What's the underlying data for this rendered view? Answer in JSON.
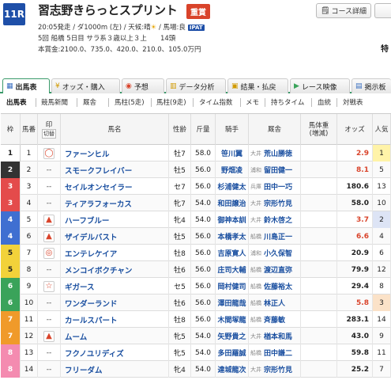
{
  "header": {
    "race_number": "11R",
    "title": "習志野きらっとスプリント",
    "grade": "重賞",
    "course_button": "コース詳細",
    "info_line1": "20:05発走 / ダ1000m (左) / 天候:晴",
    "track_condition": "/ 馬場:良",
    "ipat": "IPAT",
    "info_line2": "5回 船橋 5日目 サラ系３歳以上３上",
    "horse_count": "14頭",
    "prize": "本賞金:2100.0、735.0、420.0、210.0、105.0万円",
    "right_fragment": "特"
  },
  "tabs": [
    {
      "label": "出馬表",
      "icon": "table-icon"
    },
    {
      "label": "オッズ・購入",
      "icon": "coins-icon"
    },
    {
      "label": "予想",
      "icon": "forecast-icon"
    },
    {
      "label": "データ分析",
      "icon": "chart-icon"
    },
    {
      "label": "結果・払戻",
      "icon": "result-icon"
    },
    {
      "label": "レース映像",
      "icon": "video-icon"
    },
    {
      "label": "掲示板",
      "icon": "board-icon"
    }
  ],
  "subtabs": [
    "出馬表",
    "競馬新聞",
    "厩舎",
    "馬柱(5走)",
    "馬柱(9走)",
    "タイム指数",
    "メモ",
    "持ちタイム",
    "血統",
    "対戦表"
  ],
  "columns": [
    "枠",
    "馬番",
    "印",
    "馬名",
    "性齢",
    "斤量",
    "騎手",
    "厩舎",
    "馬体重(増減)",
    "オッズ",
    "人気"
  ],
  "mark_header": [
    "印",
    "印"
  ],
  "mark_sub": "切替",
  "colors": {
    "waku1": "#ffffff",
    "waku2": "#333333",
    "waku3": "#e44b4b",
    "waku4": "#3f6fd1",
    "waku5": "#f2d23a",
    "waku6": "#3aa35a",
    "waku7": "#f09a2a",
    "waku8": "#f48bb0",
    "accent": "#3a9a6a",
    "odds_hot": "#d9432a"
  },
  "rows": [
    {
      "waku": "1",
      "uma": "1",
      "mark": "circle",
      "horse": "ファーンヒル",
      "age": "牡7",
      "weight": "58.0",
      "jockey": "笹川翼",
      "area": "大井",
      "trainer": "荒山勝徳",
      "odds": "2.9",
      "hot": true,
      "pop": "1"
    },
    {
      "waku": "2",
      "uma": "2",
      "mark": "--",
      "horse": "スモークフレイバー",
      "age": "牡5",
      "weight": "56.0",
      "jockey": "野畑凌",
      "area": "浦和",
      "trainer": "留田健一",
      "odds": "8.1",
      "hot": true,
      "pop": "5"
    },
    {
      "waku": "3",
      "uma": "3",
      "mark": "--",
      "horse": "セイルオンセイラー",
      "age": "セ7",
      "weight": "56.0",
      "jockey": "杉浦健太",
      "area": "兵庫",
      "trainer": "田中一巧",
      "odds": "180.6",
      "hot": false,
      "pop": "13"
    },
    {
      "waku": "3",
      "uma": "4",
      "mark": "--",
      "horse": "ティアラフォーカス",
      "age": "牝7",
      "weight": "54.0",
      "jockey": "和田譲治",
      "area": "大井",
      "trainer": "宗形竹見",
      "odds": "58.0",
      "hot": false,
      "pop": "10"
    },
    {
      "waku": "4",
      "uma": "5",
      "mark": "triangle",
      "horse": "ハーフブルー",
      "age": "牝4",
      "weight": "54.0",
      "jockey": "御神本訓",
      "area": "大井",
      "trainer": "鈴木啓之",
      "odds": "3.7",
      "hot": true,
      "pop": "2"
    },
    {
      "waku": "4",
      "uma": "6",
      "mark": "triangle",
      "horse": "ザイデルバスト",
      "age": "牡5",
      "weight": "56.0",
      "jockey": "本橋孝太",
      "area": "船橋",
      "trainer": "川島正一",
      "odds": "6.6",
      "hot": true,
      "pop": "4"
    },
    {
      "waku": "5",
      "uma": "7",
      "mark": "double",
      "horse": "エンテレケイア",
      "age": "牡8",
      "weight": "56.0",
      "jockey": "吉原寛人",
      "area": "浦和",
      "trainer": "小久保智",
      "odds": "20.9",
      "hot": false,
      "pop": "6"
    },
    {
      "waku": "5",
      "uma": "8",
      "mark": "--",
      "horse": "メンコイボクチャン",
      "age": "牡6",
      "weight": "56.0",
      "jockey": "庄司大輔",
      "area": "船橋",
      "trainer": "渡辺直弥",
      "odds": "79.9",
      "hot": false,
      "pop": "12"
    },
    {
      "waku": "6",
      "uma": "9",
      "mark": "star",
      "horse": "ギガース",
      "age": "セ5",
      "weight": "56.0",
      "jockey": "岡村健司",
      "area": "船橋",
      "trainer": "佐藤裕太",
      "odds": "29.4",
      "hot": false,
      "pop": "8"
    },
    {
      "waku": "6",
      "uma": "10",
      "mark": "--",
      "horse": "ワンダーランド",
      "age": "牡6",
      "weight": "56.0",
      "jockey": "澤田龍哉",
      "area": "船橋",
      "trainer": "林正人",
      "odds": "5.8",
      "hot": true,
      "pop": "3"
    },
    {
      "waku": "7",
      "uma": "11",
      "mark": "--",
      "horse": "カールスパート",
      "age": "牡8",
      "weight": "56.0",
      "jockey": "木間塚龍",
      "area": "船橋",
      "trainer": "斉藤敏",
      "odds": "283.1",
      "hot": false,
      "pop": "14"
    },
    {
      "waku": "7",
      "uma": "12",
      "mark": "triangle",
      "horse": "ムーム",
      "age": "牝5",
      "weight": "54.0",
      "jockey": "矢野貴之",
      "area": "大井",
      "trainer": "楢本和馬",
      "odds": "43.0",
      "hot": false,
      "pop": "9"
    },
    {
      "waku": "8",
      "uma": "13",
      "mark": "--",
      "horse": "フクノユリディズ",
      "age": "牝5",
      "weight": "54.0",
      "jockey": "多田羅誠",
      "area": "船橋",
      "trainer": "田中謙二",
      "odds": "59.8",
      "hot": false,
      "pop": "11"
    },
    {
      "waku": "8",
      "uma": "14",
      "mark": "--",
      "horse": "フリーダム",
      "age": "牝4",
      "weight": "54.0",
      "jockey": "達城龍次",
      "area": "大井",
      "trainer": "宗形竹見",
      "odds": "25.2",
      "hot": false,
      "pop": "7"
    }
  ]
}
